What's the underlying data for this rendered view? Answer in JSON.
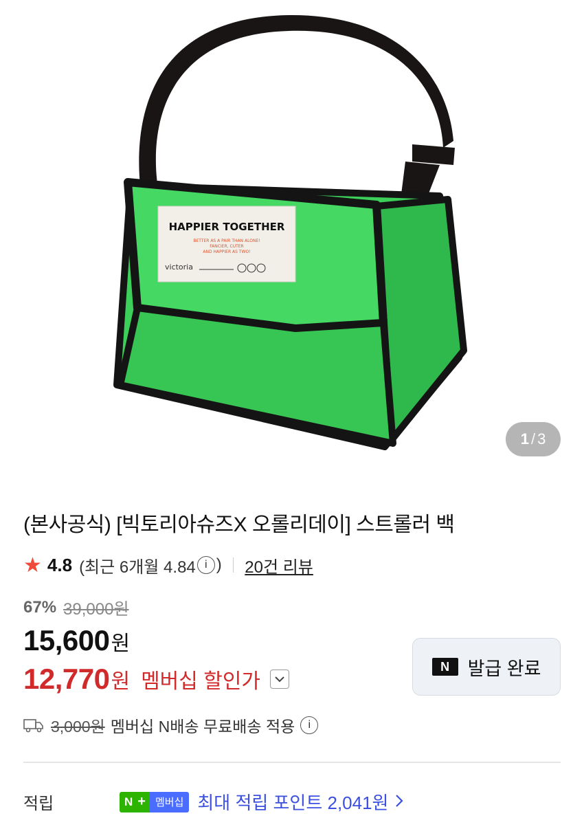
{
  "gallery": {
    "current": "1",
    "total": "3",
    "separator": "/",
    "label_lines": [
      "HAPPIER TOGETHER",
      "BETTER AS A PAIR THAN ALONE!",
      "FANCIER, CUTER",
      "AND HAPPIER AS TWO!",
      "victoria"
    ]
  },
  "product": {
    "title": "(본사공식) [빅토리아슈즈X 오롤리데이] 스트롤러 백"
  },
  "rating": {
    "score": "4.8",
    "recent_text": "(최근 6개월 4.84",
    "recent_close": ")",
    "reviews": "20건 리뷰"
  },
  "pricing": {
    "discount_rate": "67%",
    "original_price": "39,000원",
    "price": "15,600",
    "price_unit": "원",
    "member_price": "12,770",
    "member_unit": "원",
    "member_label": "멤버십 할인가"
  },
  "coupon": {
    "label": "발급 완료",
    "logo": "N"
  },
  "shipping": {
    "fee": "3,000원",
    "text": "멤버십 N배송 무료배송 적용"
  },
  "points": {
    "label": "적립",
    "badge_n": "N",
    "badge_plus": "+",
    "badge_member": "멤버십",
    "text": "최대 적립 포인트 2,041원"
  },
  "colors": {
    "accent_red": "#d12a2a",
    "star": "#f04b3a",
    "points_blue": "#3b4fe0",
    "bag_green": "#3ccf5a"
  }
}
